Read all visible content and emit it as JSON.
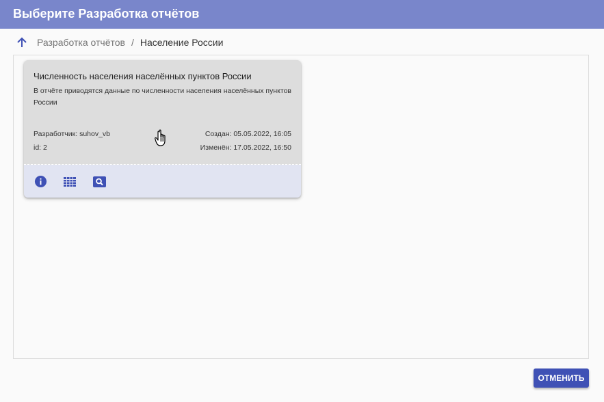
{
  "dialog": {
    "title": "Выберите Разработка отчётов"
  },
  "breadcrumb": {
    "up_icon": "arrow-up-icon",
    "parent": "Разработка отчётов",
    "separator": "/",
    "current": "Население России"
  },
  "report_card": {
    "title": "Численность населения населённых пунктов России",
    "description": "В отчёте приводятся данные по численности населения населённых пунктов России",
    "developer": "Разработчик: suhov_vb",
    "created": "Создан: 05.05.2022, 16:05",
    "id": "id: 2",
    "modified": "Изменён: 17.05.2022, 16:50",
    "actions": [
      {
        "icon": "info-icon"
      },
      {
        "icon": "grid-icon"
      },
      {
        "icon": "search-preview-icon"
      }
    ]
  },
  "footer": {
    "cancel_label": "ОТМЕНИТЬ"
  },
  "colors": {
    "header": "#7986cb",
    "accent": "#3f51b5",
    "card": "#dddddd",
    "card_actions": "#e1e4f2"
  }
}
